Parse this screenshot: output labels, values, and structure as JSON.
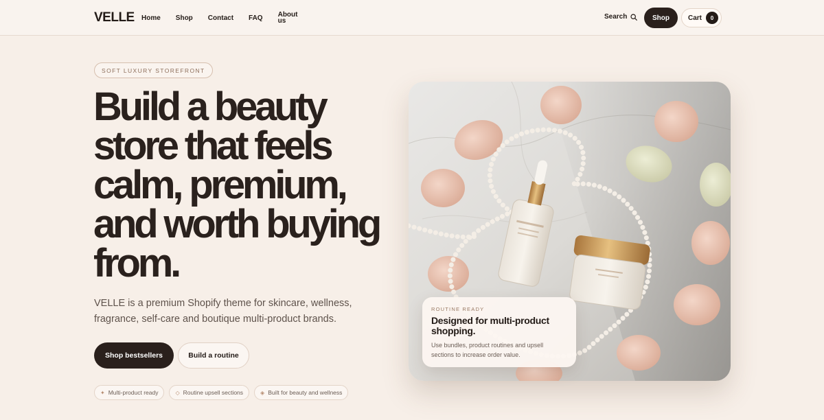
{
  "header": {
    "logo": "VELLE",
    "nav": [
      "Home",
      "Shop",
      "Contact",
      "FAQ",
      "About us"
    ],
    "search_label": "Search",
    "search_icon": "search-icon",
    "shop_button": "Shop",
    "cart_label": "Cart",
    "cart_count": "0"
  },
  "hero": {
    "eyebrow": "SOFT LUXURY STOREFRONT",
    "headline": "Build a beauty store that feels calm, premium, and worth buying from.",
    "subcopy": "VELLE is a premium Shopify theme for skincare, wellness, fragrance, self-care and boutique multi-product brands.",
    "primary_cta": "Shop bestsellers",
    "secondary_cta": "Build a routine",
    "chips": [
      {
        "glyph": "✦",
        "label": "Multi-product ready"
      },
      {
        "glyph": "◇",
        "label": "Routine upsell sections"
      },
      {
        "glyph": "◈",
        "label": "Built for beauty and wellness"
      }
    ]
  },
  "feature_card": {
    "eyebrow": "ROUTINE READY",
    "title": "Designed for multi-product shopping.",
    "body": "Use bundles, product routines and upsell sections to increase order value."
  },
  "colors": {
    "background": "#f7efe8",
    "dark": "#2a201c",
    "accent": "#b58a6e"
  }
}
